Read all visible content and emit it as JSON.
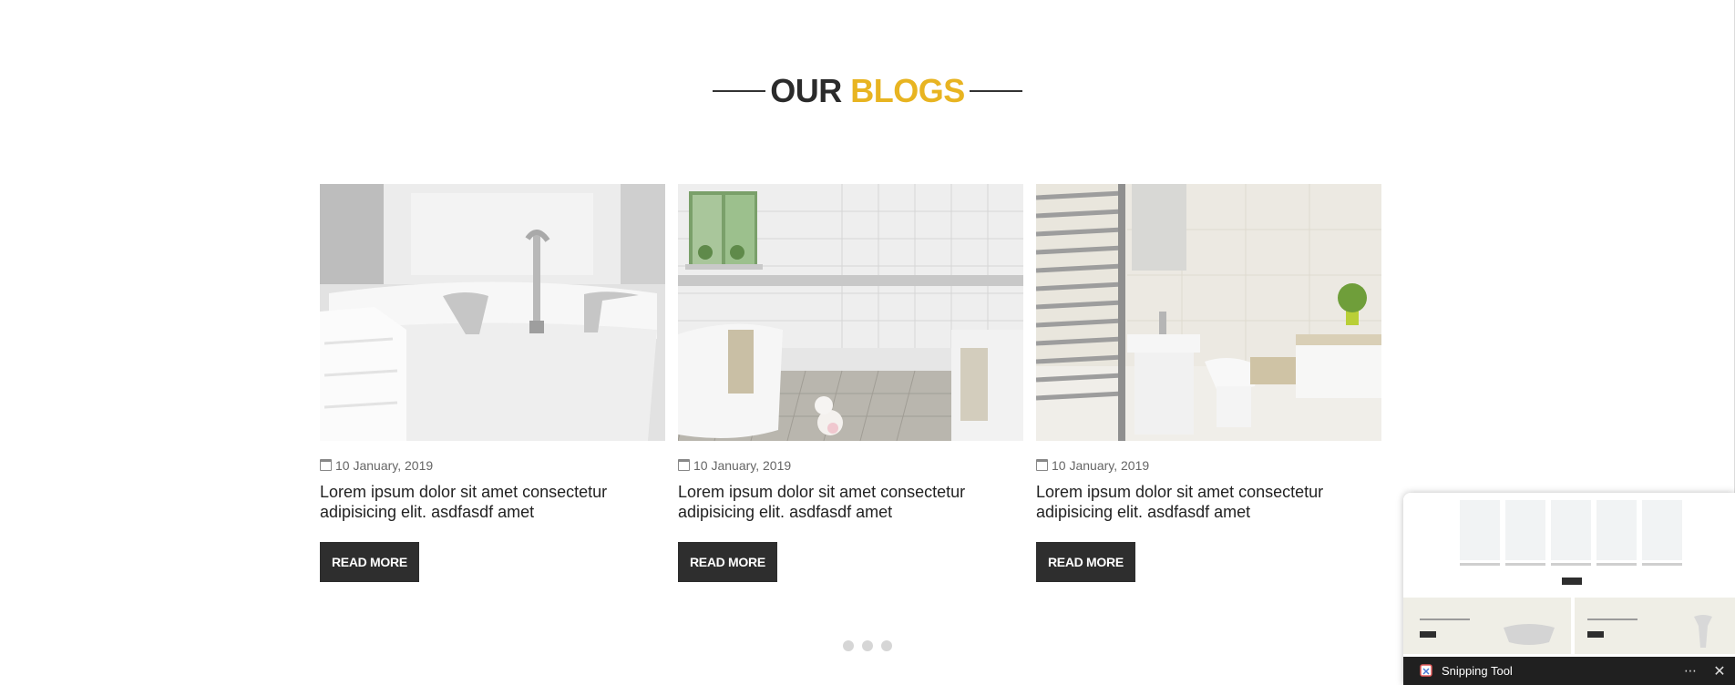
{
  "heading": {
    "part1": "OUR",
    "part2": "BLOGS",
    "accent_color": "#e8b421",
    "dark_color": "#2b2b2b"
  },
  "posts": [
    {
      "image": "bathtub-faucet-photo",
      "date": "10 January, 2019",
      "title": "Lorem ipsum dolor sit amet consectetur adipisicing elit. asdfasdf amet",
      "button": "READ MORE"
    },
    {
      "image": "white-tiled-bathroom-photo",
      "date": "10 January, 2019",
      "title": "Lorem ipsum dolor sit amet consectetur adipisicing elit. asdfasdf amet",
      "button": "READ MORE"
    },
    {
      "image": "bathroom-towel-rail-photo",
      "date": "10 January, 2019",
      "title": "Lorem ipsum dolor sit amet consectetur adipisicing elit. asdfasdf amet",
      "button": "READ MORE"
    }
  ],
  "carousel": {
    "page_count": 3
  },
  "snipping_tool": {
    "title": "Snipping Tool",
    "more": "⋯",
    "close": "✕"
  },
  "colors": {
    "button_bg": "#2e2e2e",
    "snip_bar_bg": "#202020"
  }
}
